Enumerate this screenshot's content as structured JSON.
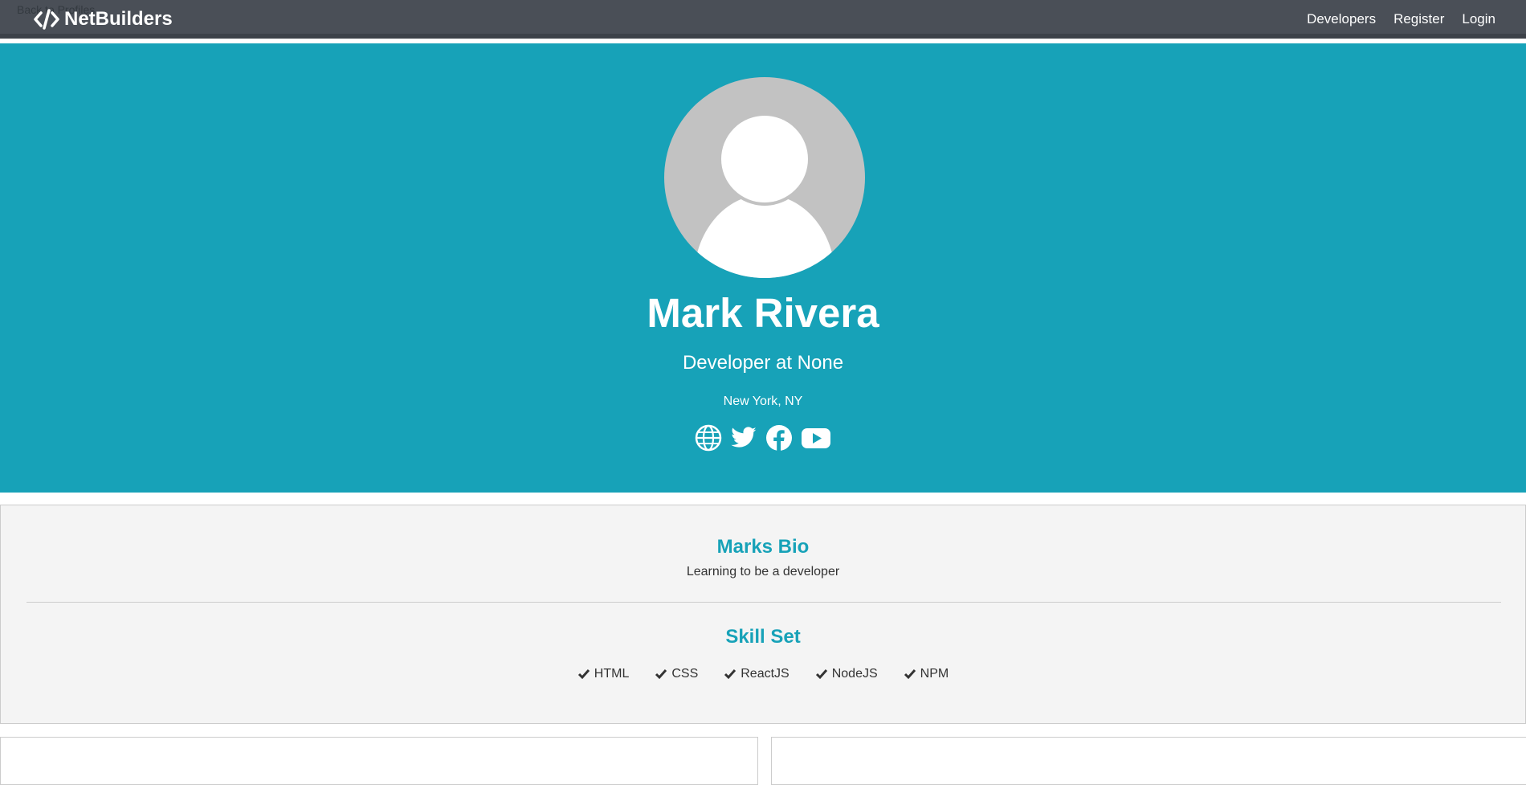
{
  "navbar": {
    "back_link": "Back to Profiles",
    "brand": "NetBuilders",
    "links": [
      "Developers",
      "Register",
      "Login"
    ]
  },
  "profile": {
    "name": "Mark Rivera",
    "status": "Developer at None",
    "location": "New York, NY",
    "social_icons": [
      "globe-icon",
      "twitter-icon",
      "facebook-icon",
      "youtube-icon"
    ]
  },
  "about": {
    "bio_title": "Marks Bio",
    "bio": "Learning to be a developer",
    "skills_title": "Skill Set",
    "skills": [
      "HTML",
      "CSS",
      "ReactJS",
      "NodeJS",
      "NPM"
    ]
  },
  "colors": {
    "primary": "#17a2b8",
    "navbar": "#4a4f57",
    "light": "#f4f4f4"
  }
}
